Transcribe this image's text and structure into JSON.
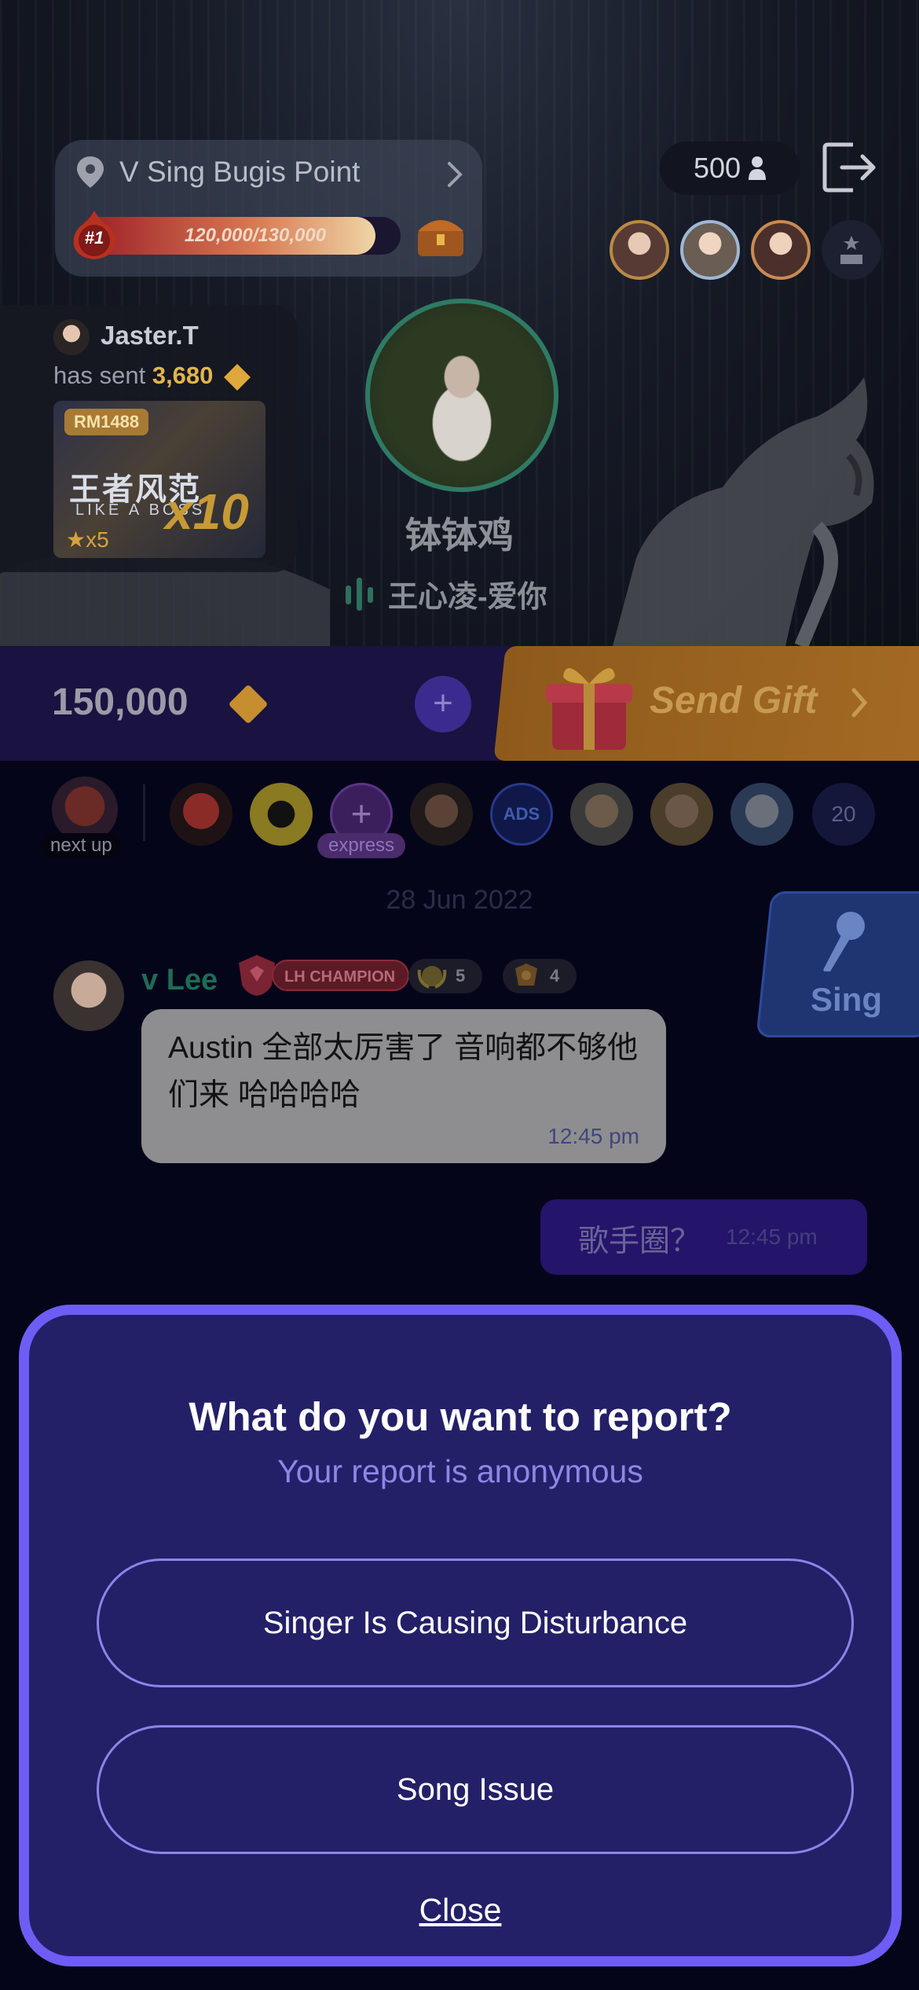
{
  "venue": {
    "name": "V Sing Bugis Point",
    "rank": "#1",
    "progress_text": "120,000/130,000",
    "progress_fraction": 0.923
  },
  "header": {
    "viewer_count": "500"
  },
  "gift_feed": {
    "sender": "Jaster.T",
    "sent_label": "has sent",
    "amount": "3,680",
    "gift_tag": "RM1488",
    "gift_title": "王者风范",
    "gift_subtitle": "LIKE A BOSS",
    "gift_star": "★x5",
    "multiplier": "x10"
  },
  "singer": {
    "name": "钵钵鸡",
    "song": "王心凌-爱你"
  },
  "gift_bar": {
    "balance": "150,000",
    "plus_label": "+",
    "send_gift_label": "Send Gift"
  },
  "queue": {
    "next_up_label": "next up",
    "plus_label": "+",
    "express_label": "express",
    "ads_label": "ADS",
    "count": "20"
  },
  "chat": {
    "date": "28 Jun 2022",
    "sing_label": "Sing",
    "messages": [
      {
        "sender": "v Lee",
        "badge": "LH CHAMPION",
        "level_a": "5",
        "level_b": "4",
        "text": "Austin 全部太厉害了 音响都不够他们来 哈哈哈哈",
        "time": "12:45 pm"
      },
      {
        "text": "歌手圈？",
        "time": "12:45 pm"
      }
    ]
  },
  "report_modal": {
    "title": "What do you want to report?",
    "subtitle": "Your report is anonymous",
    "options": [
      "Singer Is Causing Disturbance",
      "Song Issue"
    ],
    "close_label": "Close"
  },
  "colors": {
    "accent": "#6d5df5",
    "modal_bg": "#232068",
    "gift_gold": "#c79a52"
  }
}
